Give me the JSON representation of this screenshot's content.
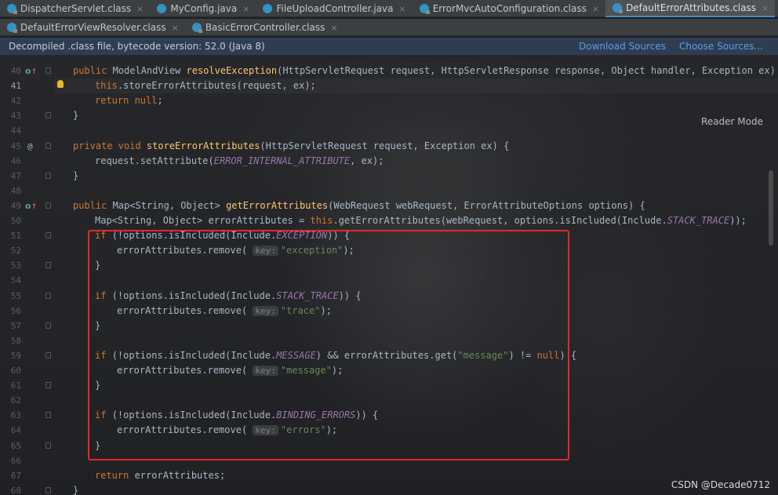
{
  "tabs_row1": [
    {
      "label": "DispatcherServlet.class",
      "type": "class",
      "active": false
    },
    {
      "label": "MyConfig.java",
      "type": "java",
      "active": false
    },
    {
      "label": "FileUploadController.java",
      "type": "java",
      "active": false
    },
    {
      "label": "ErrorMvcAutoConfiguration.class",
      "type": "class",
      "active": false
    },
    {
      "label": "DefaultErrorAttributes.class",
      "type": "class",
      "active": true
    }
  ],
  "tabs_row2": [
    {
      "label": "DefaultErrorViewResolver.class",
      "type": "class",
      "active": false
    },
    {
      "label": "BasicErrorController.class",
      "type": "class",
      "active": false
    }
  ],
  "close_glyph": "×",
  "notice": {
    "message": "Decompiled .class file, bytecode version: 52.0 (Java 8)",
    "download_sources": "Download Sources",
    "choose_sources": "Choose Sources..."
  },
  "reader_mode": "Reader Mode",
  "watermark": "CSDN @Decade0712",
  "line_numbers": [
    "40",
    "41",
    "42",
    "43",
    "44",
    "45",
    "46",
    "47",
    "48",
    "49",
    "50",
    "51",
    "52",
    "53",
    "54",
    "55",
    "56",
    "57",
    "58",
    "59",
    "60",
    "61",
    "62",
    "63",
    "64",
    "65",
    "66",
    "67",
    "68"
  ],
  "inlay_hint_key": "key:",
  "code": {
    "l40": {
      "kw1": "public ",
      "type": "ModelAndView ",
      "fn": "resolveException",
      "rest": "(HttpServletRequest request, HttpServletResponse response, Object handler, Exception ex) {"
    },
    "l41": {
      "kw": "this",
      "rest": ".storeErrorAttributes(request, ex);"
    },
    "l42": {
      "kw": "return null",
      "rest": ";"
    },
    "l43": {
      "rest": "}"
    },
    "l45": {
      "kw1": "private void ",
      "fn": "storeErrorAttributes",
      "rest": "(HttpServletRequest request, Exception ex) {"
    },
    "l46": {
      "pre": "request.setAttribute(",
      "const": "ERROR_INTERNAL_ATTRIBUTE",
      "rest": ", ex);"
    },
    "l47": {
      "rest": "}"
    },
    "l49": {
      "kw1": "public ",
      "type": "Map<String, Object> ",
      "fn": "getErrorAttributes",
      "rest": "(WebRequest webRequest, ErrorAttributeOptions options) {"
    },
    "l50": {
      "pre": "Map<String, Object> errorAttributes = ",
      "kw": "this",
      "mid": ".getErrorAttributes(webRequest, options.isIncluded(Include.",
      "const": "STACK_TRACE",
      "rest": "));"
    },
    "l51": {
      "kw": "if ",
      "pre": "(!options.isIncluded(Include.",
      "const": "EXCEPTION",
      "rest": ")) {"
    },
    "l52": {
      "pre": "errorAttributes.remove( ",
      "str": "\"exception\"",
      "rest": ");"
    },
    "l53": {
      "rest": "}"
    },
    "l55": {
      "kw": "if ",
      "pre": "(!options.isIncluded(Include.",
      "const": "STACK_TRACE",
      "rest": ")) {"
    },
    "l56": {
      "pre": "errorAttributes.remove( ",
      "str": "\"trace\"",
      "rest": ");"
    },
    "l57": {
      "rest": "}"
    },
    "l59": {
      "kw": "if ",
      "pre": "(!options.isIncluded(Include.",
      "const": "MESSAGE",
      "mid": ") && errorAttributes.get(",
      "str": "\"message\"",
      "mid2": ") != ",
      "kw2": "null",
      "rest": ") {"
    },
    "l60": {
      "pre": "errorAttributes.remove( ",
      "str": "\"message\"",
      "rest": ");"
    },
    "l61": {
      "rest": "}"
    },
    "l63": {
      "kw": "if ",
      "pre": "(!options.isIncluded(Include.",
      "const": "BINDING_ERRORS",
      "rest": ")) {"
    },
    "l64": {
      "pre": "errorAttributes.remove( ",
      "str": "\"errors\"",
      "rest": ");"
    },
    "l65": {
      "rest": "}"
    },
    "l67": {
      "kw": "return ",
      "rest": "errorAttributes;"
    },
    "l68": {
      "rest": "}"
    }
  }
}
